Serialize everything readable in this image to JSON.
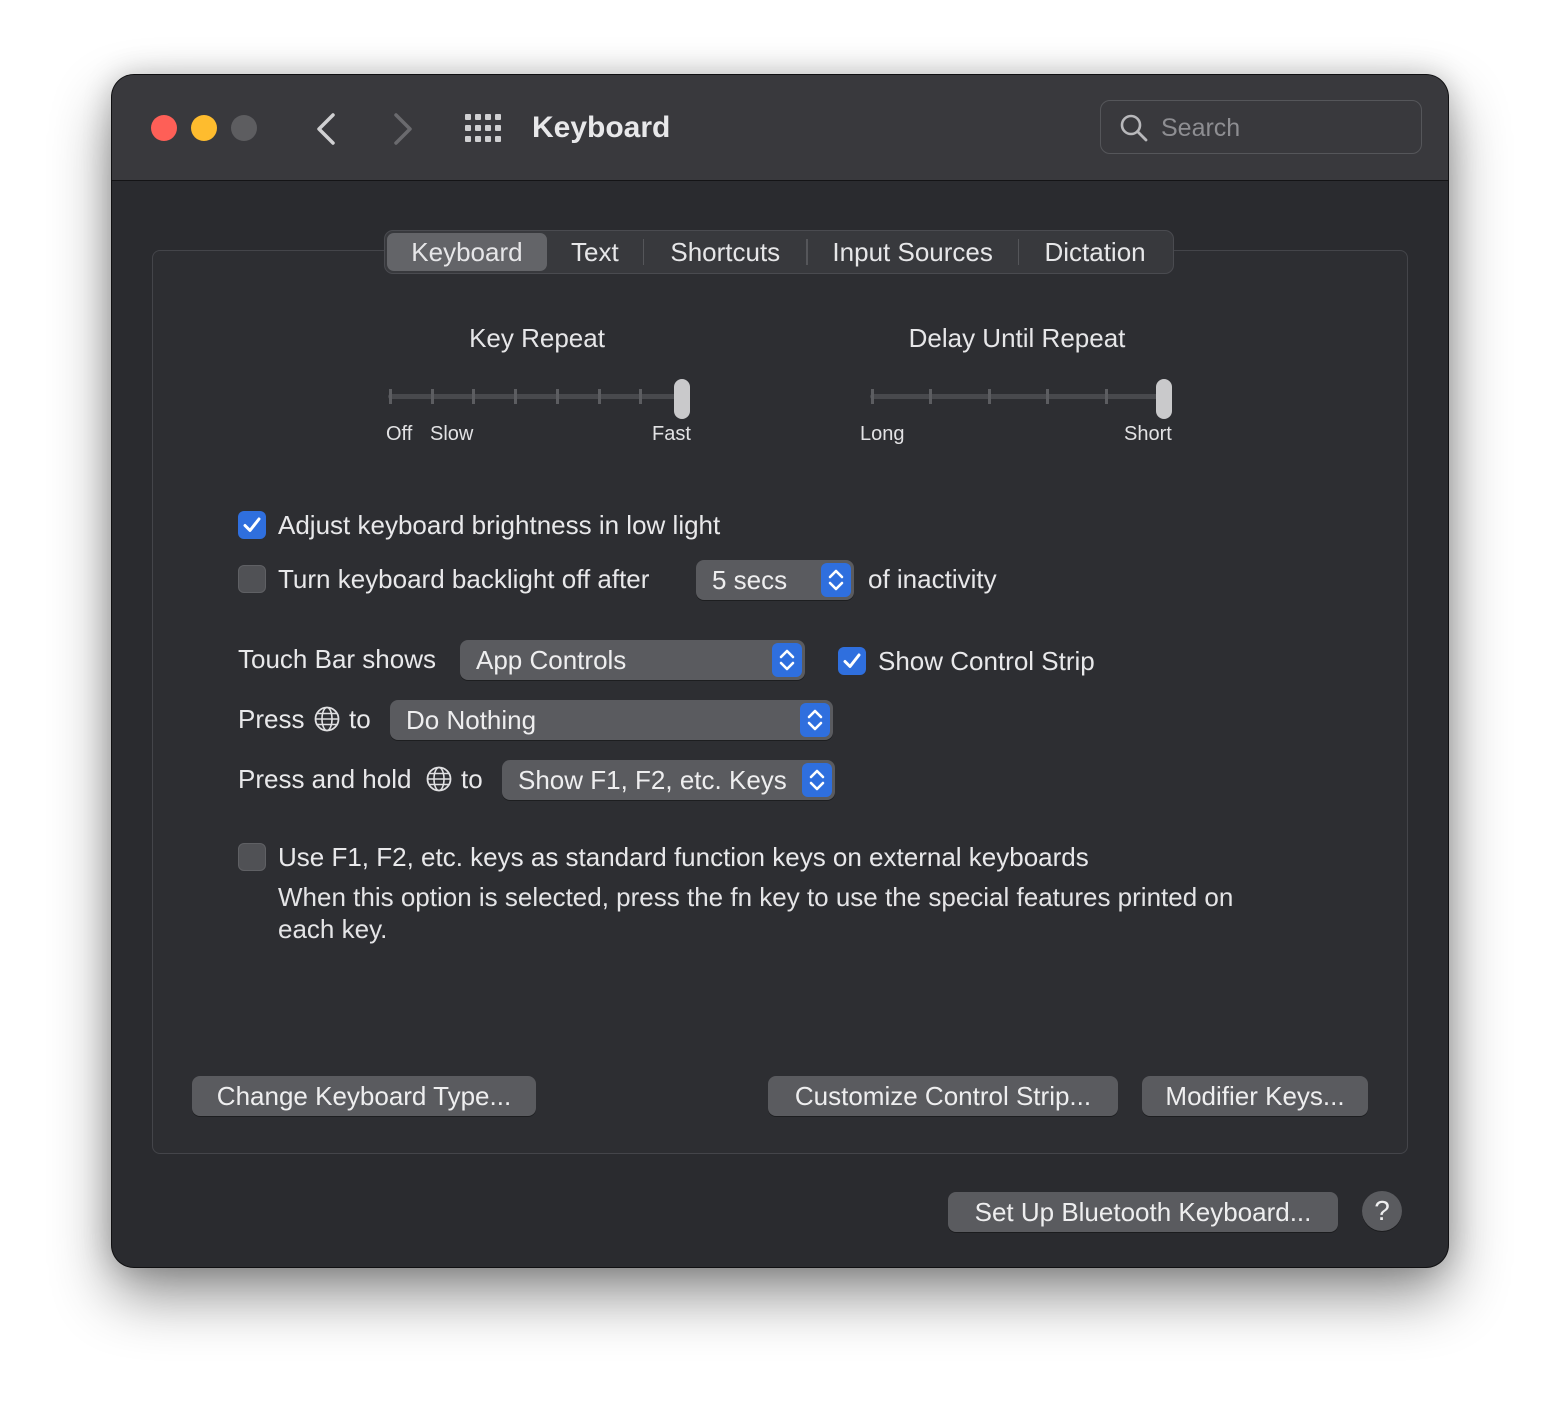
{
  "window": {
    "title": "Keyboard",
    "search_placeholder": "Search"
  },
  "tabs": [
    {
      "label": "Keyboard",
      "active": true
    },
    {
      "label": "Text",
      "active": false
    },
    {
      "label": "Shortcuts",
      "active": false
    },
    {
      "label": "Input Sources",
      "active": false
    },
    {
      "label": "Dictation",
      "active": false
    }
  ],
  "key_repeat": {
    "label": "Key Repeat",
    "min_label_off": "Off",
    "min_label_slow": "Slow",
    "max_label": "Fast",
    "stops": 8,
    "value_stop": 8
  },
  "delay_until_repeat": {
    "label": "Delay Until Repeat",
    "min_label": "Long",
    "max_label": "Short",
    "stops": 6,
    "value_stop": 6
  },
  "options": {
    "adjust_brightness": {
      "label": "Adjust keyboard brightness in low light",
      "checked": true
    },
    "backlight_off": {
      "label": "Turn keyboard backlight off after",
      "checked": false,
      "value": "5 secs",
      "suffix": "of inactivity"
    },
    "touch_bar": {
      "label": "Touch Bar shows",
      "value": "App Controls"
    },
    "show_control_strip": {
      "label": "Show Control Strip",
      "checked": true
    },
    "press_globe": {
      "label_before": "Press",
      "label_after": "to",
      "value": "Do Nothing"
    },
    "press_hold_globe": {
      "label_before": "Press and hold",
      "label_after": "to",
      "value": "Show F1, F2, etc. Keys"
    },
    "function_keys": {
      "label": "Use F1, F2, etc. keys as standard function keys on external keyboards",
      "checked": false,
      "description_line1": "When this option is selected, press the fn key to use the special features printed on",
      "description_line2": "each key."
    }
  },
  "buttons": {
    "change_keyboard_type": "Change Keyboard Type...",
    "customize_control_strip": "Customize Control Strip...",
    "modifier_keys": "Modifier Keys...",
    "bluetooth_keyboard": "Set Up Bluetooth Keyboard...",
    "help": "?"
  },
  "colors": {
    "accent": "#2f6fde",
    "window_bg": "#2a2b2f",
    "titlebar_bg": "#39393d",
    "close": "#fe5f57",
    "minimize": "#febc2e"
  }
}
